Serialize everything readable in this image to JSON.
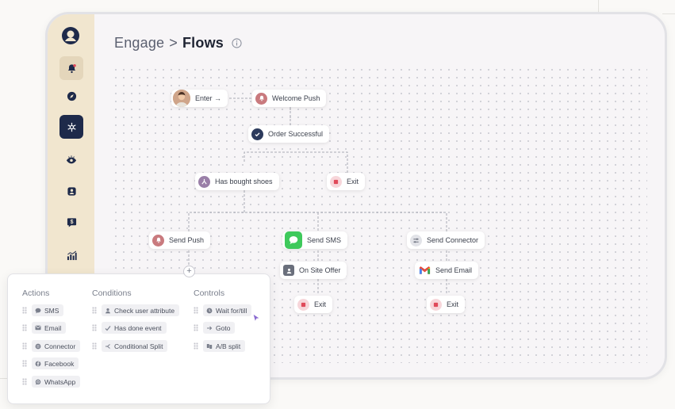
{
  "header": {
    "crumb": "Engage",
    "separator": ">",
    "current": "Flows"
  },
  "sidebar": {
    "items": [
      "notifications",
      "compass",
      "flows",
      "eye",
      "user-badge",
      "payments",
      "analytics"
    ]
  },
  "nodes": {
    "enter": {
      "label": "Enter →"
    },
    "welcome_push": {
      "label": "Welcome Push"
    },
    "order_successful": {
      "label": "Order Successful"
    },
    "has_bought_shoes": {
      "label": "Has bought shoes"
    },
    "exit_top": {
      "label": "Exit"
    },
    "send_push": {
      "label": "Send Push"
    },
    "send_sms": {
      "label": "Send SMS"
    },
    "send_connector": {
      "label": "Send Connector"
    },
    "on_site_offer": {
      "label": "On Site Offer"
    },
    "send_email": {
      "label": "Send Email"
    },
    "exit_mid": {
      "label": "Exit"
    },
    "exit_right": {
      "label": "Exit"
    }
  },
  "panel": {
    "actions": {
      "heading": "Actions",
      "items": [
        "SMS",
        "Email",
        "Connector",
        "Facebook",
        "WhatsApp"
      ]
    },
    "conditions": {
      "heading": "Conditions",
      "items": [
        "Check user attribute",
        "Has done event",
        "Conditional Split"
      ]
    },
    "controls": {
      "heading": "Controls",
      "items": [
        "Wait for/till",
        "Goto",
        "A/B split"
      ]
    }
  },
  "add_button": {
    "label": "+"
  },
  "colors": {
    "sidebar": "#f1e6cf",
    "primary": "#1e2a4a",
    "push": "#c97a7e",
    "exit": "#e04a5a",
    "sms": "#3ec95b"
  }
}
